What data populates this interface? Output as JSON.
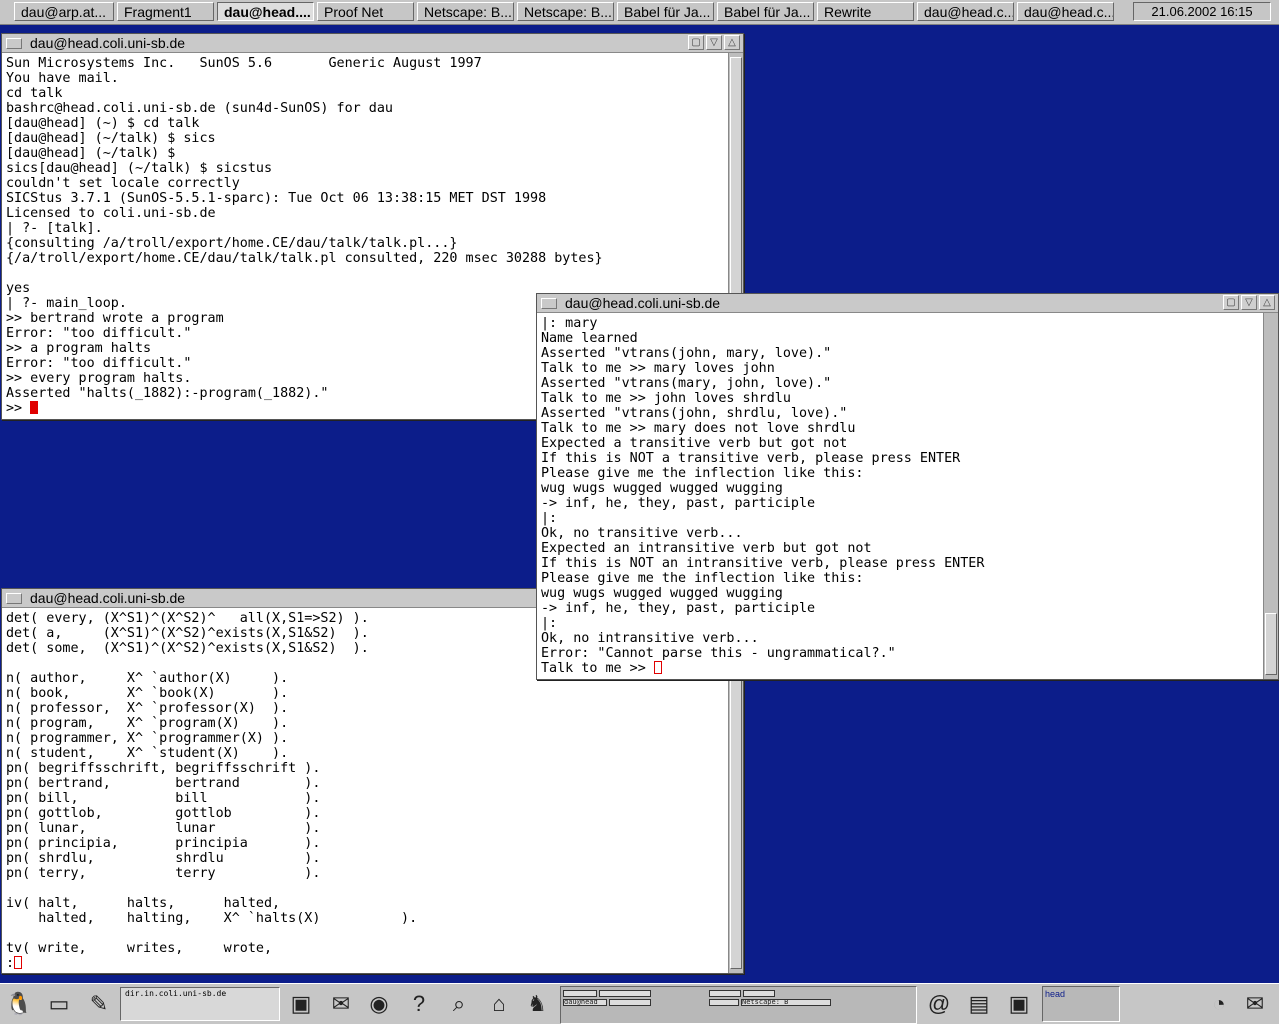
{
  "taskbar": {
    "tasks": [
      "dau@arp.at...",
      "Fragment1",
      "dau@head....",
      "Proof Net",
      "Netscape: B...",
      "Netscape: B...",
      "Babel für Ja...",
      "Babel für Ja...",
      "Rewrite",
      "dau@head.c...",
      "dau@head.c..."
    ],
    "clock": "21.06.2002 16:15"
  },
  "window1": {
    "title": "dau@head.coli.uni-sb.de",
    "lines": [
      "Sun Microsystems Inc.   SunOS 5.6       Generic August 1997",
      "You have mail.",
      "cd talk",
      "bashrc@head.coli.uni-sb.de (sun4d-SunOS) for dau",
      "[dau@head] (~) $ cd talk",
      "[dau@head] (~/talk) $ sics",
      "[dau@head] (~/talk) $",
      "sics[dau@head] (~/talk) $ sicstus",
      "couldn't set locale correctly",
      "SICStus 3.7.1 (SunOS-5.5.1-sparc): Tue Oct 06 13:38:15 MET DST 1998",
      "Licensed to coli.uni-sb.de",
      "| ?- [talk].",
      "{consulting /a/troll/export/home.CE/dau/talk/talk.pl...}",
      "{/a/troll/export/home.CE/dau/talk/talk.pl consulted, 220 msec 30288 bytes}",
      "",
      "yes",
      "| ?- main_loop.",
      ">> bertrand wrote a program",
      "Error: \"too difficult.\"",
      ">> a program halts",
      "Error: \"too difficult.\"",
      ">> every program halts.",
      "Asserted \"halts(_1882):-program(_1882).\""
    ],
    "prompt": ">> "
  },
  "window2": {
    "title": "dau@head.coli.uni-sb.de",
    "lines": [
      "|: mary",
      "Name learned",
      "Asserted \"vtrans(john, mary, love).\"",
      "Talk to me >> mary loves john",
      "Asserted \"vtrans(mary, john, love).\"",
      "Talk to me >> john loves shrdlu",
      "Asserted \"vtrans(john, shrdlu, love).\"",
      "Talk to me >> mary does not love shrdlu",
      "Expected a transitive verb but got not",
      "If this is NOT a transitive verb, please press ENTER",
      "Please give me the inflection like this:",
      "wug wugs wugged wugged wugging",
      "-> inf, he, they, past, participle",
      "|:",
      "Ok, no transitive verb...",
      "Expected an intransitive verb but got not",
      "If this is NOT an intransitive verb, please press ENTER",
      "Please give me the inflection like this:",
      "wug wugs wugged wugged wugging",
      "-> inf, he, they, past, participle",
      "|:",
      "Ok, no intransitive verb...",
      "Error: \"Cannot parse this - ungrammatical?.\""
    ],
    "prompt": "Talk to me >> "
  },
  "window3": {
    "title": "dau@head.coli.uni-sb.de",
    "lines": [
      "det( every, (X^S1)^(X^S2)^   all(X,S1=>S2) ).",
      "det( a,     (X^S1)^(X^S2)^exists(X,S1&S2)  ).",
      "det( some,  (X^S1)^(X^S2)^exists(X,S1&S2)  ).",
      "",
      "n( author,     X^ `author(X)     ).",
      "n( book,       X^ `book(X)       ).",
      "n( professor,  X^ `professor(X)  ).",
      "n( program,    X^ `program(X)    ).",
      "n( programmer, X^ `programmer(X) ).",
      "n( student,    X^ `student(X)    ).",
      "pn( begriffsschrift, begriffsschrift ).",
      "pn( bertrand,        bertrand        ).",
      "pn( bill,            bill            ).",
      "pn( gottlob,         gottlob         ).",
      "pn( lunar,           lunar           ).",
      "pn( principia,       principia       ).",
      "pn( shrdlu,          shrdlu          ).",
      "pn( terry,           terry           ).",
      "",
      "iv( halt,      halts,      halted,",
      "    halted,    halting,    X^ `halts(X)          ).",
      "",
      "tv( write,     writes,     wrote,"
    ],
    "prompt": ":"
  },
  "panel": {
    "hostname": "dir.in.coli.uni-sb.de",
    "pager_label": "head",
    "mini_netscape": "Netscape: B",
    "mini_dau": "dau@head"
  }
}
